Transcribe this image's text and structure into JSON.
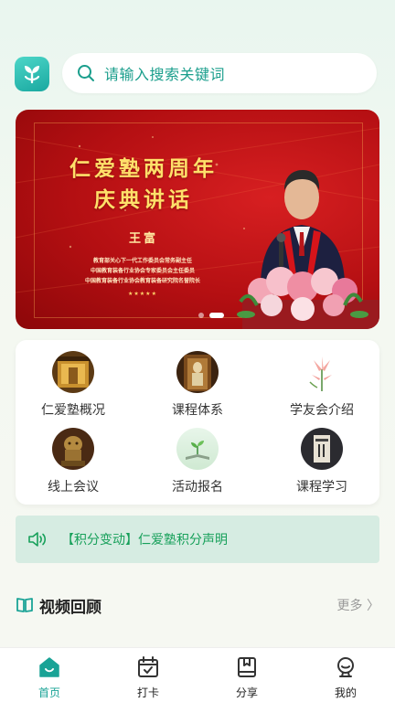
{
  "search": {
    "placeholder": "请输入搜索关键词"
  },
  "banner": {
    "title_line1": "仁爱塾两周年",
    "title_line2": "庆典讲话",
    "speaker_name": "王富",
    "roles": [
      "教育部关心下一代工作委员会常务副主任",
      "中国教育装备行业协会专家委员会主任委员",
      "中国教育装备行业协会教育装备研究院名誉院长"
    ],
    "stars": "★★★★★",
    "slide_count": 2,
    "active_slide": 2
  },
  "menu": {
    "items": [
      {
        "label": "仁爱塾概况",
        "icon": "temple-hall-icon"
      },
      {
        "label": "课程体系",
        "icon": "statue-icon"
      },
      {
        "label": "学友会介绍",
        "icon": "lily-flower-icon"
      },
      {
        "label": "线上会议",
        "icon": "bronze-lion-icon"
      },
      {
        "label": "活动报名",
        "icon": "sprout-book-icon"
      },
      {
        "label": "课程学习",
        "icon": "book-cover-icon"
      }
    ]
  },
  "notice": {
    "text": "【积分变动】仁爱塾积分声明",
    "icon": "speaker-icon"
  },
  "section": {
    "title": "视频回顾",
    "more": "更多"
  },
  "tabbar": {
    "items": [
      {
        "label": "首页",
        "icon": "home-icon",
        "active": true
      },
      {
        "label": "打卡",
        "icon": "calendar-check-icon",
        "active": false
      },
      {
        "label": "分享",
        "icon": "book-share-icon",
        "active": false
      },
      {
        "label": "我的",
        "icon": "profile-icon",
        "active": false
      }
    ]
  },
  "colors": {
    "accent": "#1aa396",
    "banner_red": "#c4161a",
    "notice_bg": "#d6ece2",
    "notice_text": "#17a05a"
  }
}
